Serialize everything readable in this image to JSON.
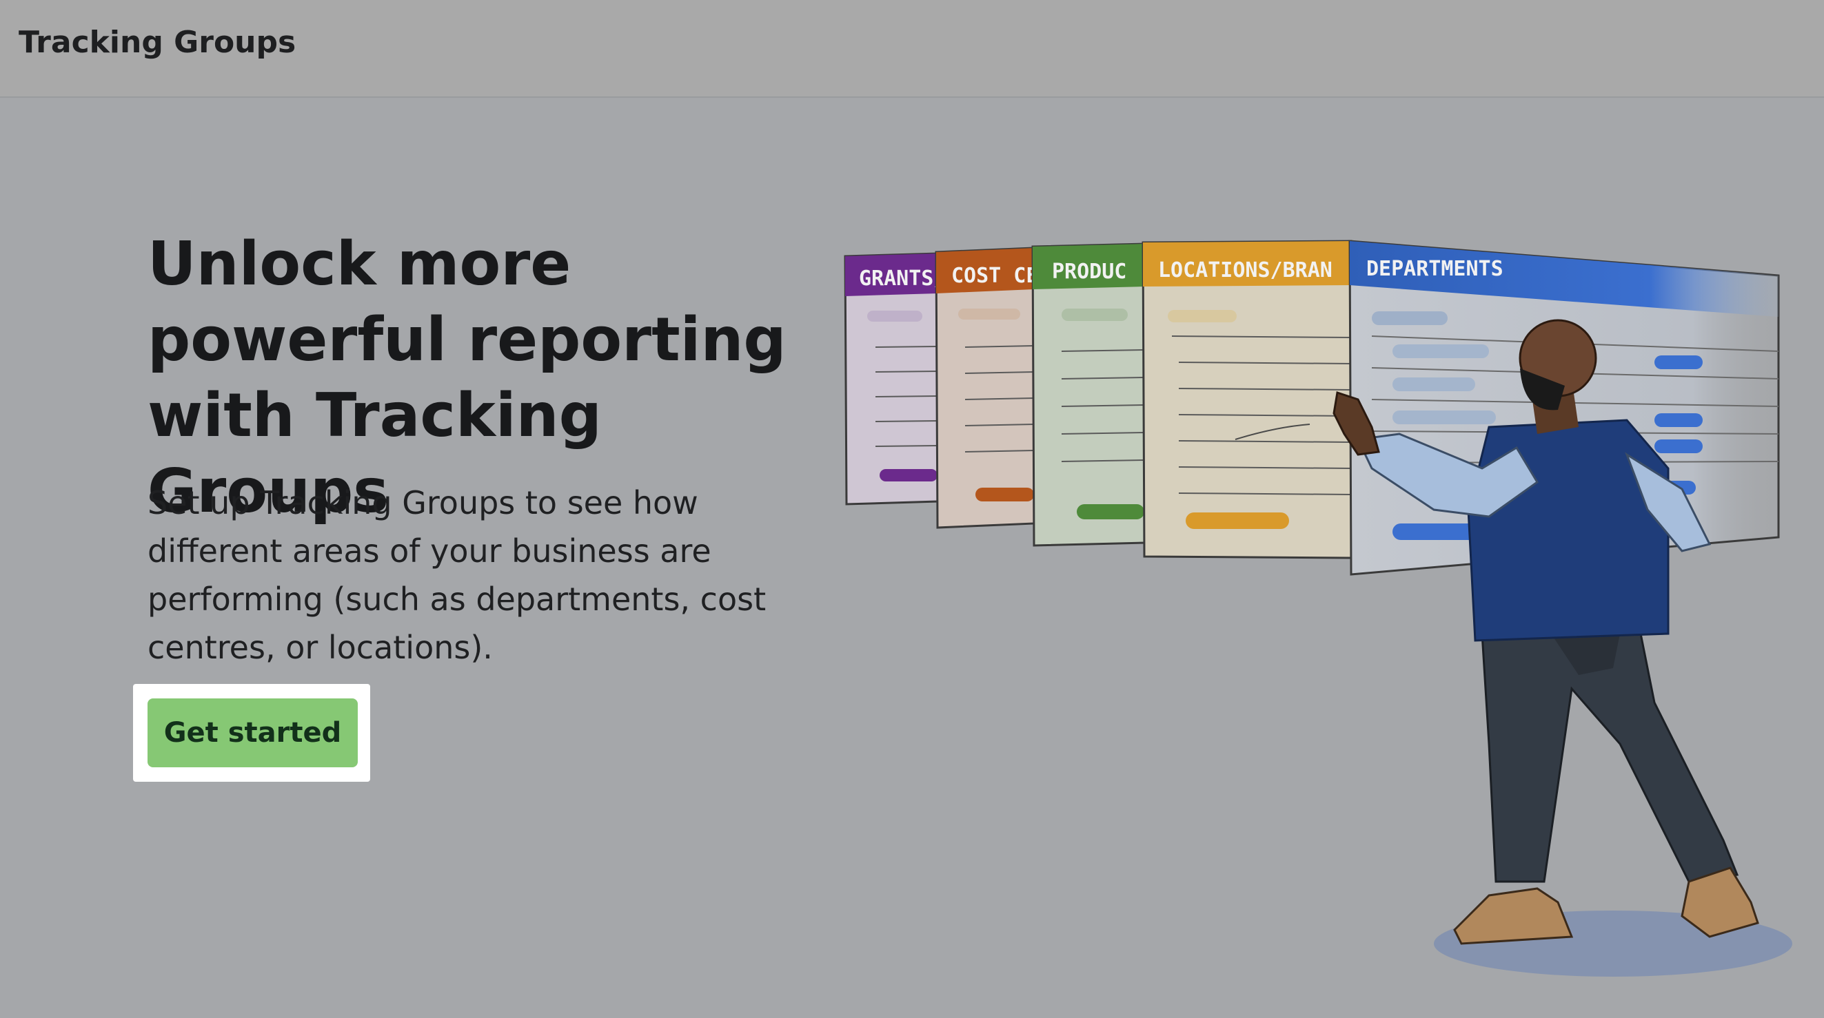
{
  "header": {
    "title": "Tracking Groups"
  },
  "hero": {
    "heading": "Unlock more powerful reporting with Tracking Groups",
    "body": "Set up Tracking Groups to see how different areas of your business are performing (such as departments, cost centres, or locations).",
    "cta_label": "Get started"
  },
  "illustration": {
    "cards": [
      {
        "label": "GRANTS/",
        "color": "#6b2a8c"
      },
      {
        "label": "COST CE",
        "color": "#b4561c"
      },
      {
        "label": "PRODUC",
        "color": "#4e8a3a"
      },
      {
        "label": "LOCATIONS/BRAN",
        "color": "#d99a2b"
      },
      {
        "label": "DEPARTMENTS",
        "color": "#2f5fb8"
      }
    ]
  },
  "colors": {
    "background": "#a5a7aa",
    "cta": "#86c874",
    "focus_ring": "#ffffff",
    "text": "#18191b"
  }
}
